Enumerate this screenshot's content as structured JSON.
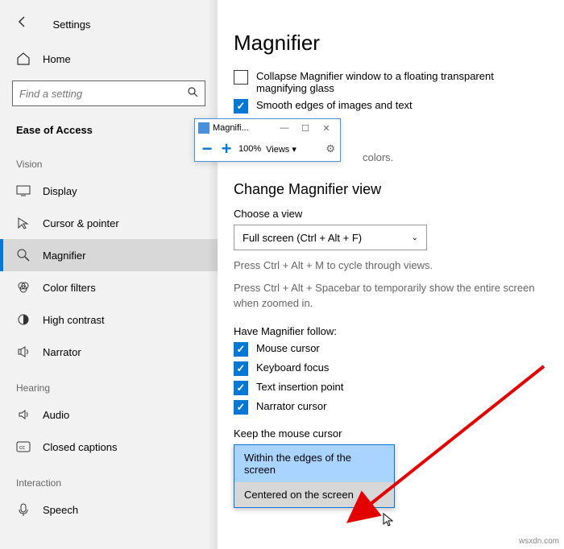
{
  "header": {
    "settings": "Settings"
  },
  "home": "Home",
  "search": {
    "placeholder": "Find a setting"
  },
  "section_main": "Ease of Access",
  "groups": {
    "vision": "Vision",
    "hearing": "Hearing",
    "interaction": "Interaction"
  },
  "nav": {
    "display": "Display",
    "cursor": "Cursor & pointer",
    "magnifier": "Magnifier",
    "color_filters": "Color filters",
    "high_contrast": "High contrast",
    "narrator": "Narrator",
    "audio": "Audio",
    "closed_captions": "Closed captions",
    "speech": "Speech"
  },
  "page": {
    "title": "Magnifier",
    "collapse": "Collapse Magnifier window to a floating transparent magnifying glass",
    "smooth": "Smooth edges of images and text",
    "invert_hint": "colors.",
    "change_view_heading": "Change Magnifier view",
    "choose_view": "Choose a view",
    "view_value": "Full screen (Ctrl + Alt + F)",
    "cycle_hint": "Press Ctrl + Alt + M to cycle through views.",
    "spacebar_hint": "Press Ctrl + Alt + Spacebar to temporarily show the entire screen when zoomed in.",
    "follow_heading": "Have Magnifier follow:",
    "follow_mouse": "Mouse cursor",
    "follow_keyboard": "Keyboard focus",
    "follow_text": "Text insertion point",
    "follow_narrator": "Narrator cursor",
    "keep_cursor": "Keep the mouse cursor",
    "opt_edges": "Within the edges of the screen",
    "opt_centered": "Centered on the screen"
  },
  "mag_window": {
    "title": "Magnifi...",
    "zoom": "100%",
    "views": "Views ▾"
  },
  "watermark": "wsxdn.com"
}
